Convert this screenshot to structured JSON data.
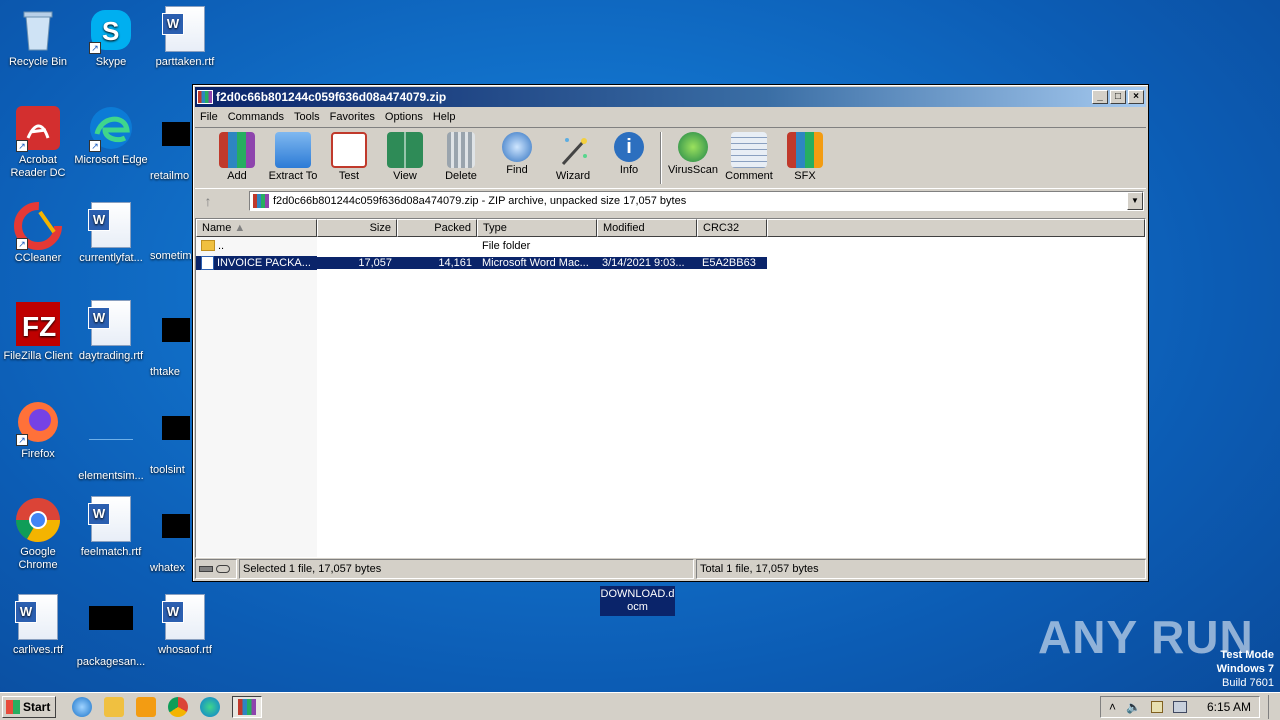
{
  "desktop_icons": [
    {
      "label": "Recycle Bin",
      "icon": "recycle-bin-icon"
    },
    {
      "label": "Skype",
      "icon": "skype-icon"
    },
    {
      "label": "parttaken.rtf",
      "icon": "word-doc-icon"
    },
    {
      "label": "Acrobat Reader DC",
      "icon": "acrobat-icon"
    },
    {
      "label": "Microsoft Edge",
      "icon": "edge-icon"
    },
    {
      "label": "retailmo",
      "icon": "black-file-icon"
    },
    {
      "label": "CCleaner",
      "icon": "ccleaner-icon"
    },
    {
      "label": "currentlyfat...",
      "icon": "word-doc-icon"
    },
    {
      "label": "sometim",
      "icon": "blank-file-icon"
    },
    {
      "label": "FileZilla Client",
      "icon": "filezilla-icon"
    },
    {
      "label": "daytrading.rtf",
      "icon": "word-doc-icon"
    },
    {
      "label": "thtake",
      "icon": "black-file-icon"
    },
    {
      "label": "Firefox",
      "icon": "firefox-icon"
    },
    {
      "label": "elementsim...",
      "icon": "blank-file-icon"
    },
    {
      "label": "toolsint",
      "icon": "black-file-icon"
    },
    {
      "label": "Google Chrome",
      "icon": "chrome-icon"
    },
    {
      "label": "feelmatch.rtf",
      "icon": "word-doc-icon"
    },
    {
      "label": "whatex",
      "icon": "black-file-icon"
    },
    {
      "label": "carlives.rtf",
      "icon": "word-doc-icon"
    },
    {
      "label": "packagesan...",
      "icon": "black-file-icon"
    },
    {
      "label": "whosaof.rtf",
      "icon": "word-doc-icon"
    }
  ],
  "window": {
    "title": "f2d0c66b801244c059f636d08a474079.zip",
    "menu": [
      "File",
      "Commands",
      "Tools",
      "Favorites",
      "Options",
      "Help"
    ],
    "toolbar": [
      {
        "label": "Add",
        "icon": "add-archive-icon"
      },
      {
        "label": "Extract To",
        "icon": "extract-folder-icon"
      },
      {
        "label": "Test",
        "icon": "test-checklist-icon"
      },
      {
        "label": "View",
        "icon": "view-book-icon"
      },
      {
        "label": "Delete",
        "icon": "trash-icon"
      },
      {
        "label": "Find",
        "icon": "magnifier-icon"
      },
      {
        "label": "Wizard",
        "icon": "wand-icon"
      },
      {
        "label": "Info",
        "icon": "info-icon"
      },
      {
        "label": "VirusScan",
        "icon": "virus-scan-icon"
      },
      {
        "label": "Comment",
        "icon": "comment-icon"
      },
      {
        "label": "SFX",
        "icon": "sfx-box-icon"
      }
    ],
    "address": "f2d0c66b801244c059f636d08a474079.zip - ZIP archive, unpacked size 17,057 bytes",
    "columns": [
      "Name",
      "Size",
      "Packed",
      "Type",
      "Modified",
      "CRC32"
    ],
    "rows": [
      {
        "name": "..",
        "size": "",
        "packed": "",
        "type": "File folder",
        "modified": "",
        "crc": ""
      },
      {
        "name": "INVOICE PACKA...",
        "size": "17,057",
        "packed": "14,161",
        "type": "Microsoft Word Mac...",
        "modified": "3/14/2021 9:03...",
        "crc": "E5A2BB63"
      }
    ],
    "status_left": "Selected 1 file, 17,057 bytes",
    "status_right": "Total 1 file, 17,057 bytes"
  },
  "stray_label": "DOWNLOAD.d ocm",
  "watermark": {
    "brand": "ANY RUN",
    "line1": "Test Mode",
    "line2": "Windows 7",
    "line3": "Build 7601"
  },
  "taskbar": {
    "start": "Start",
    "clock": "6:15 AM"
  }
}
